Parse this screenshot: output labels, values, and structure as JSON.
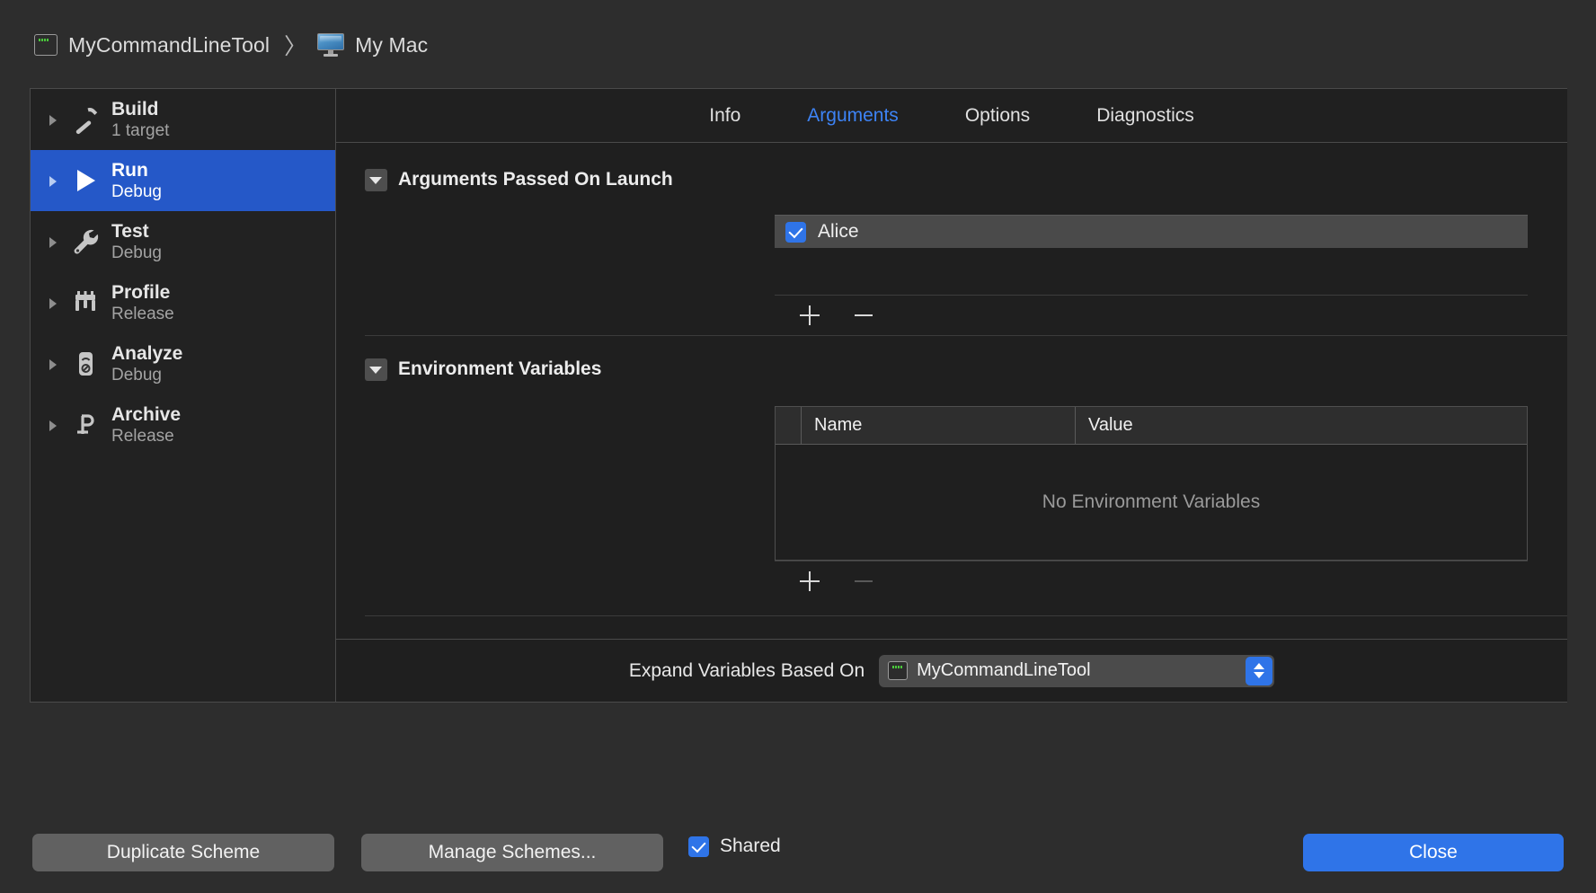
{
  "titlebar": {
    "scheme_name": "MyCommandLineTool",
    "scheme_icon": "command-line-tool-icon",
    "separator": "〉",
    "destination_name": "My Mac",
    "destination_icon": "mac-display-icon"
  },
  "sidebar": {
    "items": [
      {
        "title": "Build",
        "subtitle": "1 target",
        "icon": "hammer-icon",
        "selected": false
      },
      {
        "title": "Run",
        "subtitle": "Debug",
        "icon": "play-icon",
        "selected": true
      },
      {
        "title": "Test",
        "subtitle": "Debug",
        "icon": "wrench-icon",
        "selected": false
      },
      {
        "title": "Profile",
        "subtitle": "Release",
        "icon": "gauge-icon",
        "selected": false
      },
      {
        "title": "Analyze",
        "subtitle": "Debug",
        "icon": "analyze-icon",
        "selected": false
      },
      {
        "title": "Archive",
        "subtitle": "Release",
        "icon": "archive-icon",
        "selected": false
      }
    ]
  },
  "tabs": [
    {
      "label": "Info",
      "active": false
    },
    {
      "label": "Arguments",
      "active": true
    },
    {
      "label": "Options",
      "active": false
    },
    {
      "label": "Diagnostics",
      "active": false
    }
  ],
  "arguments_section": {
    "title": "Arguments Passed On Launch",
    "expanded": true,
    "rows": [
      {
        "value": "Alice",
        "checked": true
      }
    ],
    "add_button": "+",
    "remove_button": "−",
    "add_enabled": true,
    "remove_enabled": true
  },
  "environment_section": {
    "title": "Environment Variables",
    "expanded": true,
    "columns": [
      "Name",
      "Value"
    ],
    "rows": [],
    "empty_text": "No Environment Variables",
    "add_button": "+",
    "remove_button": "−",
    "add_enabled": true,
    "remove_enabled": false
  },
  "expand_variables": {
    "label": "Expand Variables Based On",
    "selected": "MyCommandLineTool",
    "icon": "command-line-tool-icon",
    "options": [
      "MyCommandLineTool"
    ]
  },
  "footer": {
    "duplicate_scheme": "Duplicate Scheme",
    "manage_schemes": "Manage Schemes...",
    "shared_label": "Shared",
    "shared_checked": true,
    "close": "Close"
  },
  "colors": {
    "accent_blue": "#2f74e8",
    "selection_blue": "#2558c8",
    "tab_active": "#3d83f5",
    "window_bg": "#2d2d2d",
    "panel_bg": "#1f1f1f",
    "sidebar_bg": "#222222",
    "row_bg": "#4a4a4a"
  }
}
